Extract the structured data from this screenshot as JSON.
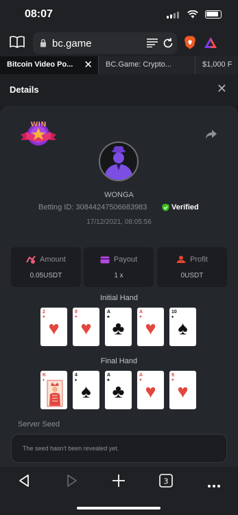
{
  "status_bar": {
    "time": "08:07"
  },
  "browser": {
    "url": "bc.game",
    "tabs": [
      {
        "title": "Bitcoin Video Po...",
        "active": true
      },
      {
        "title": "BC.Game: Crypto...",
        "active": false
      },
      {
        "title": "$1,000 F",
        "active": false
      }
    ],
    "tab_count": "3"
  },
  "modal": {
    "title": "Details"
  },
  "player": {
    "badge": "WIN",
    "username": "WONGA",
    "betting_id_label": "Betting ID:",
    "betting_id": "30844247506683983",
    "verified_label": "Verified",
    "date": "17/12/2021, 08:05:56"
  },
  "stats": {
    "amount": {
      "label": "Amount",
      "value": "0.05USDT"
    },
    "payout": {
      "label": "Payout",
      "value": "1 x"
    },
    "profit": {
      "label": "Profit",
      "value": "0USDT"
    }
  },
  "initial_hand": {
    "title": "Initial Hand",
    "cards": [
      {
        "rank": "2",
        "suit": "♥",
        "color": "red"
      },
      {
        "rank": "8",
        "suit": "♥",
        "color": "red"
      },
      {
        "rank": "A",
        "suit": "♣",
        "color": "black"
      },
      {
        "rank": "A",
        "suit": "♥",
        "color": "red"
      },
      {
        "rank": "10",
        "suit": "♠",
        "color": "black"
      }
    ]
  },
  "final_hand": {
    "title": "Final Hand",
    "cards": [
      {
        "rank": "K",
        "suit": "♦",
        "color": "red",
        "face": true
      },
      {
        "rank": "4",
        "suit": "♠",
        "color": "black"
      },
      {
        "rank": "A",
        "suit": "♣",
        "color": "black"
      },
      {
        "rank": "A",
        "suit": "♥",
        "color": "red"
      },
      {
        "rank": "9",
        "suit": "♥",
        "color": "red"
      }
    ]
  },
  "server_seed": {
    "label": "Server Seed",
    "message": "The seed hasn't been revealed yet."
  },
  "colors": {
    "accent": "#8a5cf6",
    "verified": "#3bc117",
    "red_suit": "#e2473f"
  }
}
